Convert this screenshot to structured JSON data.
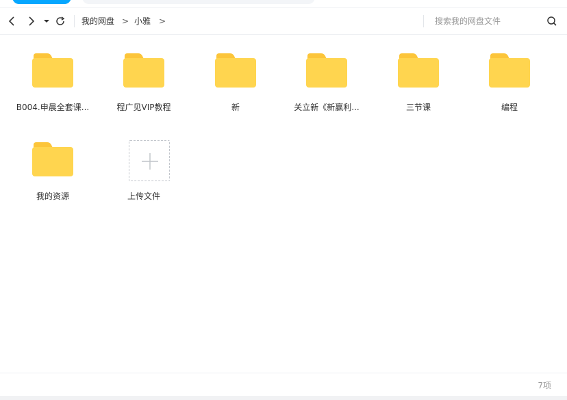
{
  "toolbar": {
    "breadcrumb": [
      "我的网盘",
      "小雅"
    ],
    "breadcrumb_separator": ">",
    "search_placeholder": "搜索我的网盘文件"
  },
  "items": [
    {
      "name": "B004.申晨全套课...",
      "type": "folder"
    },
    {
      "name": "程广见VIP教程",
      "type": "folder"
    },
    {
      "name": "新",
      "type": "folder"
    },
    {
      "name": "关立新《新赢利...",
      "type": "folder"
    },
    {
      "name": "三节课",
      "type": "folder"
    },
    {
      "name": "编程",
      "type": "folder"
    },
    {
      "name": "我的资源",
      "type": "folder"
    }
  ],
  "upload": {
    "label": "上传文件",
    "icon": "plus-icon"
  },
  "footer": {
    "count": "7项"
  },
  "colors": {
    "folder": "#ffd54f",
    "folder_tab": "#fcc53a",
    "accent": "#06a7ff"
  }
}
